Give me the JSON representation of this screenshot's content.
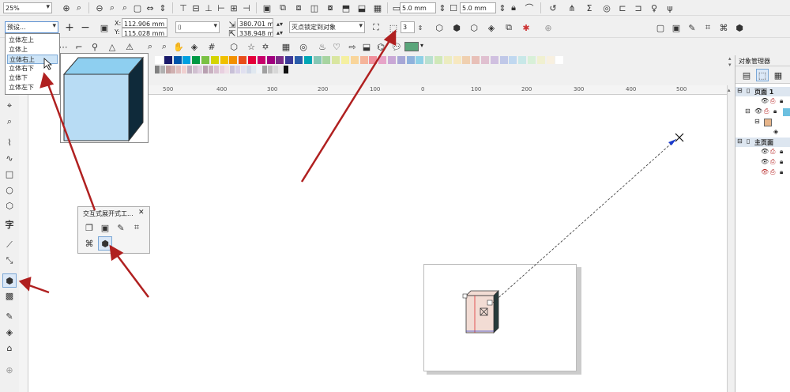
{
  "toolbar1": {
    "zoom": "25%",
    "outline1": "5.0 mm",
    "outline2": "5.0 mm"
  },
  "propbar": {
    "preset": "预设...",
    "x_label": "X:",
    "x_value": "112.906 mm",
    "y_label": "Y:",
    "y_value": "115.028 mm",
    "w_value": "380.701 mr",
    "h_value": "338.948 mr",
    "vanish_point": "灭点锁定到对象",
    "depth": "3"
  },
  "preset_menu": {
    "items": [
      "立体左上",
      "立体上",
      "立体右上",
      "立体右下",
      "立体下",
      "立体左下"
    ],
    "selected": 2
  },
  "ruler": {
    "labels": [
      "500",
      "400",
      "300",
      "200",
      "100",
      "0",
      "100",
      "200",
      "300",
      "400",
      "500"
    ]
  },
  "flyout": {
    "title": "交互式展开式工...",
    "close": "✕"
  },
  "object_manager": {
    "title": "对象管理器",
    "page1": "页面 1",
    "master": "主页面"
  },
  "colors": {
    "cube_front": "#b8dcf4",
    "cube_top": "#8ecff0",
    "cube_side": "#0f2a3a",
    "arrow": "#b02020",
    "accent_green": "#5aa57a"
  }
}
